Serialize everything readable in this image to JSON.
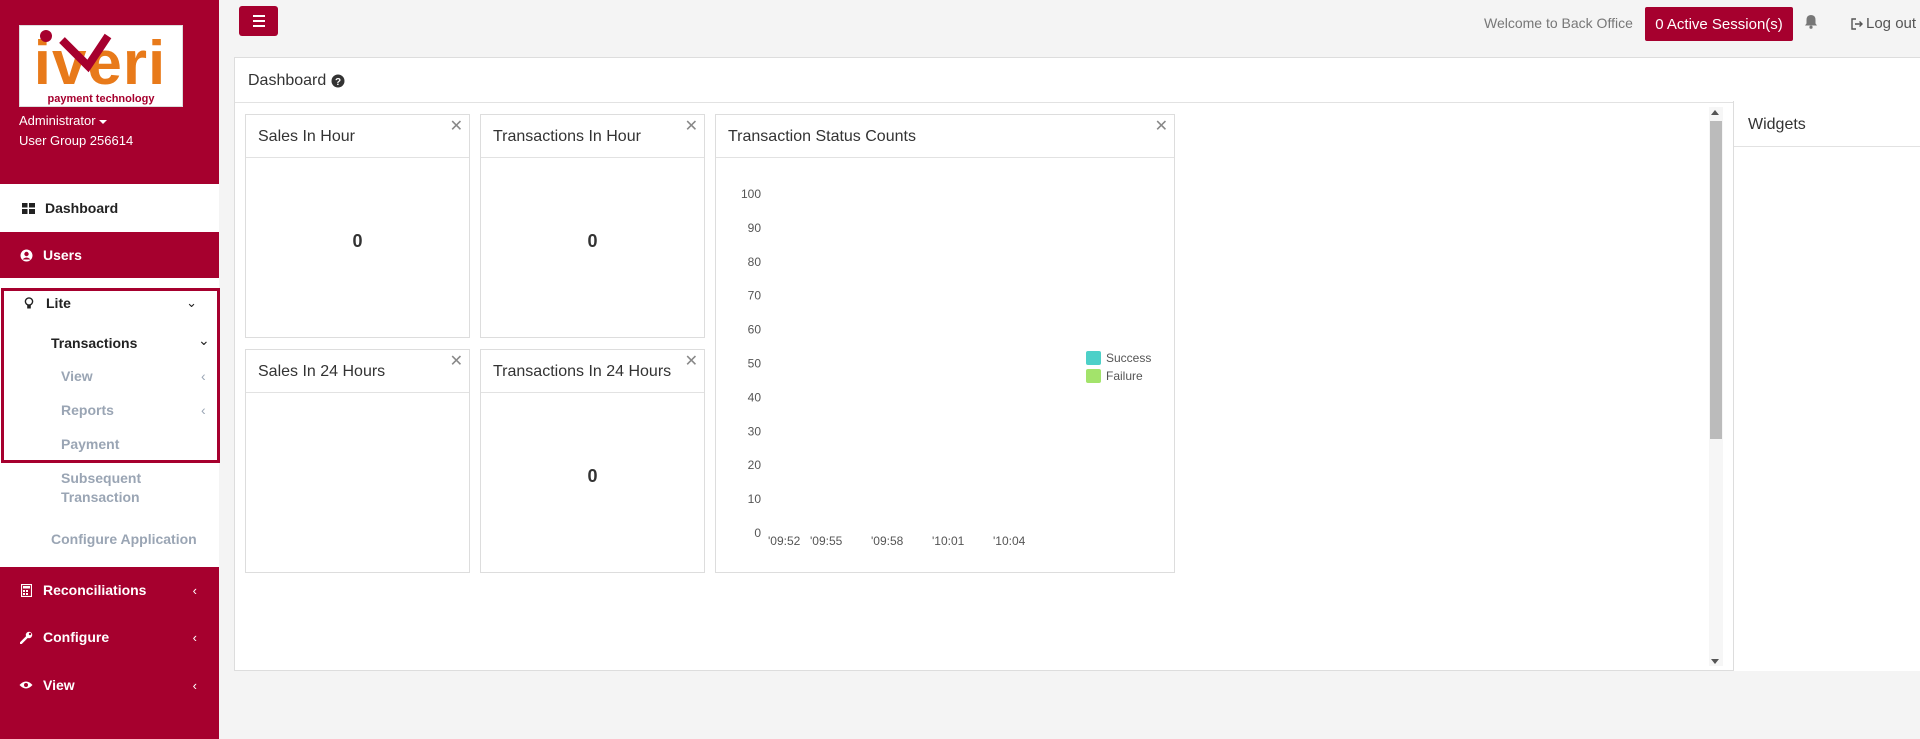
{
  "sidebar": {
    "logo": {
      "brand": "iveri",
      "tagline": "payment technology"
    },
    "user": {
      "role": "Administrator",
      "group": "User Group 256614"
    },
    "items": [
      {
        "label": "Dashboard",
        "icon": "dashboard-icon"
      },
      {
        "label": "Users",
        "icon": "user-circle-icon"
      },
      {
        "label": "Lite",
        "icon": "lightbulb-icon"
      },
      {
        "label": "Reconciliations",
        "icon": "calculator-icon"
      },
      {
        "label": "Configure",
        "icon": "wrench-icon"
      },
      {
        "label": "View",
        "icon": "eye-icon"
      }
    ],
    "lite_sub": {
      "transactions": "Transactions",
      "view": "View",
      "reports": "Reports",
      "payment": "Payment",
      "subsequent_line1": "Subsequent",
      "subsequent_line2": "Transaction",
      "configure_app": "Configure Application"
    }
  },
  "topbar": {
    "welcome": "Welcome to Back Office",
    "sessions_button": "0 Active Session(s)",
    "logout": "Log out"
  },
  "dashboard": {
    "title": "Dashboard",
    "widgets": {
      "sales_hour": {
        "title": "Sales In Hour",
        "value": "0"
      },
      "tx_hour": {
        "title": "Transactions In Hour",
        "value": "0"
      },
      "status_counts": {
        "title": "Transaction Status Counts"
      },
      "sales_24": {
        "title": "Sales In 24 Hours",
        "value": ""
      },
      "tx_24": {
        "title": "Transactions In 24 Hours",
        "value": "0"
      }
    },
    "widgets_panel_title": "Widgets"
  },
  "colors": {
    "brand": "#a6002e",
    "success": "#4dd0c8",
    "failure": "#a3e36b"
  },
  "chart_data": {
    "type": "line",
    "title": "Transaction Status Counts",
    "y_ticks": [
      "100",
      "90",
      "80",
      "70",
      "60",
      "50",
      "40",
      "30",
      "20",
      "10",
      "0"
    ],
    "x": [
      "'09:52",
      "'09:55",
      "'09:58",
      "'10:01",
      "'10:04"
    ],
    "ylim": [
      0,
      100
    ],
    "series": [
      {
        "name": "Success",
        "values": []
      },
      {
        "name": "Failure",
        "values": []
      }
    ],
    "legend": "right"
  }
}
